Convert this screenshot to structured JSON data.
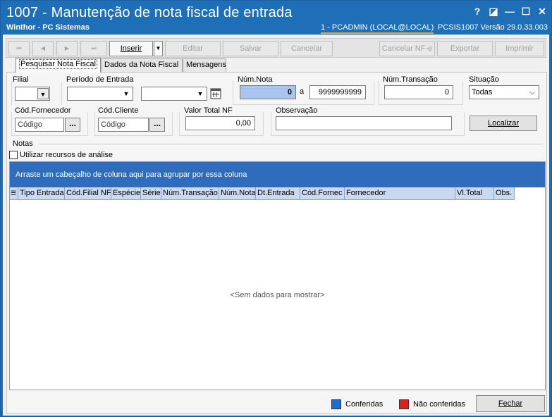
{
  "window": {
    "title": "1007 - Manutenção de nota fiscal de entrada",
    "subtitle": "Winthor - PC Sistemas",
    "user_info": "1 - PCADMIN (LOCAL@LOCAL)",
    "sys_info": "PCSIS1007  Versão  29.0.33.003",
    "help_glyph": "?",
    "restore_glyph": "◪",
    "minimize_glyph": "—",
    "maximize_glyph": "☐",
    "close_glyph": "✕"
  },
  "toolbar": {
    "first": "⏮",
    "prev": "◀",
    "next": "▶",
    "last": "⏭",
    "insert": "Inserir",
    "insert_dropdown": "▼",
    "edit": "Editar",
    "save": "Salvar",
    "cancel": "Cancelar",
    "cancel_nfe": "Cancelar NF-e",
    "export": "Exportar",
    "print": "Imprimir"
  },
  "tabs": [
    "Pesquisar Nota Fiscal",
    "Dados da Nota Fiscal",
    "Mensagens"
  ],
  "filters": {
    "filial_label": "Filial",
    "periodo_label": "Período de Entrada",
    "num_nota_label": "Núm.Nota",
    "num_nota_from": "0",
    "a_label": "a",
    "num_nota_to": "9999999999",
    "num_transacao_label": "Núm.Transação",
    "num_transacao_value": "0",
    "situacao_label": "Situação",
    "situacao_value": "Todas",
    "cod_fornecedor_label": "Cód.Fornecedor",
    "cod_fornecedor_placeholder": "Código",
    "cod_cliente_label": "Cód.Cliente",
    "cod_cliente_placeholder": "Código",
    "lookup_glyph": "...",
    "valor_total_label": "Valor Total NF",
    "valor_total_value": "0,00",
    "observacao_label": "Observação",
    "observacao_value": "",
    "localizar": "Localizar"
  },
  "notas": {
    "section_label": "Notas",
    "analysis_checkbox_label": "Utilizar recursos de análise",
    "analysis_checked": false,
    "group_hint": "Arraste um cabeçalho de coluna aqui para agrupar por essa coluna",
    "columns": [
      "Tipo Entrada",
      "Cód.Filial NF",
      "Espécie",
      "Série",
      "Núm.Transação",
      "Núm.Nota",
      "Dt.Entrada",
      "Cód.Fornec",
      "Fornecedor",
      "Vl.Total",
      "Obs."
    ],
    "empty_text": "<Sem dados para mostrar>"
  },
  "legend": {
    "conferidas": "Conferidas",
    "conferidas_color": "#1a6fd0",
    "nao_conferidas": "Não conferidas",
    "nao_conferidas_color": "#d9221c"
  },
  "footer": {
    "fechar": "Fechar"
  }
}
